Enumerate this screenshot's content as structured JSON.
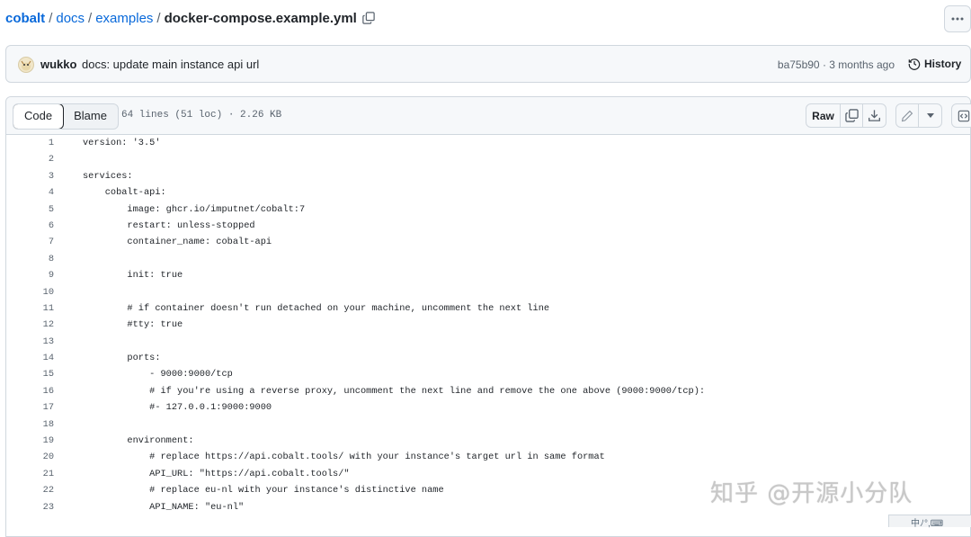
{
  "breadcrumb": {
    "root": "cobalt",
    "parts": [
      "docs",
      "examples"
    ],
    "separator": "/",
    "file": "docker-compose.example.yml"
  },
  "commit": {
    "author": "wukko",
    "message": "docs: update main instance api url",
    "meta": "ba75b90 · 3 months ago",
    "history_label": "History"
  },
  "viewer": {
    "tabs": [
      {
        "label": "Code"
      },
      {
        "label": "Blame"
      }
    ],
    "info": "64 lines (51 loc) · 2.26 KB",
    "raw_label": "Raw"
  },
  "code_lines": [
    {
      "n": "1",
      "text": "version: '3.5'"
    },
    {
      "n": "2",
      "text": ""
    },
    {
      "n": "3",
      "text": "services:"
    },
    {
      "n": "4",
      "text": "    cobalt-api:"
    },
    {
      "n": "5",
      "text": "        image: ghcr.io/imputnet/cobalt:7"
    },
    {
      "n": "6",
      "text": "        restart: unless-stopped"
    },
    {
      "n": "7",
      "text": "        container_name: cobalt-api"
    },
    {
      "n": "8",
      "text": ""
    },
    {
      "n": "9",
      "text": "        init: true"
    },
    {
      "n": "10",
      "text": ""
    },
    {
      "n": "11",
      "text": "        # if container doesn't run detached on your machine, uncomment the next line"
    },
    {
      "n": "12",
      "text": "        #tty: true"
    },
    {
      "n": "13",
      "text": ""
    },
    {
      "n": "14",
      "text": "        ports:"
    },
    {
      "n": "15",
      "text": "            - 9000:9000/tcp"
    },
    {
      "n": "16",
      "text": "            # if you're using a reverse proxy, uncomment the next line and remove the one above (9000:9000/tcp):"
    },
    {
      "n": "17",
      "text": "            #- 127.0.0.1:9000:9000"
    },
    {
      "n": "18",
      "text": ""
    },
    {
      "n": "19",
      "text": "        environment:"
    },
    {
      "n": "20",
      "text": "            # replace https://api.cobalt.tools/ with your instance's target url in same format"
    },
    {
      "n": "21",
      "text": "            API_URL: \"https://api.cobalt.tools/\""
    },
    {
      "n": "22",
      "text": "            # replace eu-nl with your instance's distinctive name"
    },
    {
      "n": "23",
      "text": "            API_NAME: \"eu-nl\""
    }
  ],
  "watermark": "知乎 @开源小分队",
  "ime_bar": "中ﾉ°,⌨"
}
